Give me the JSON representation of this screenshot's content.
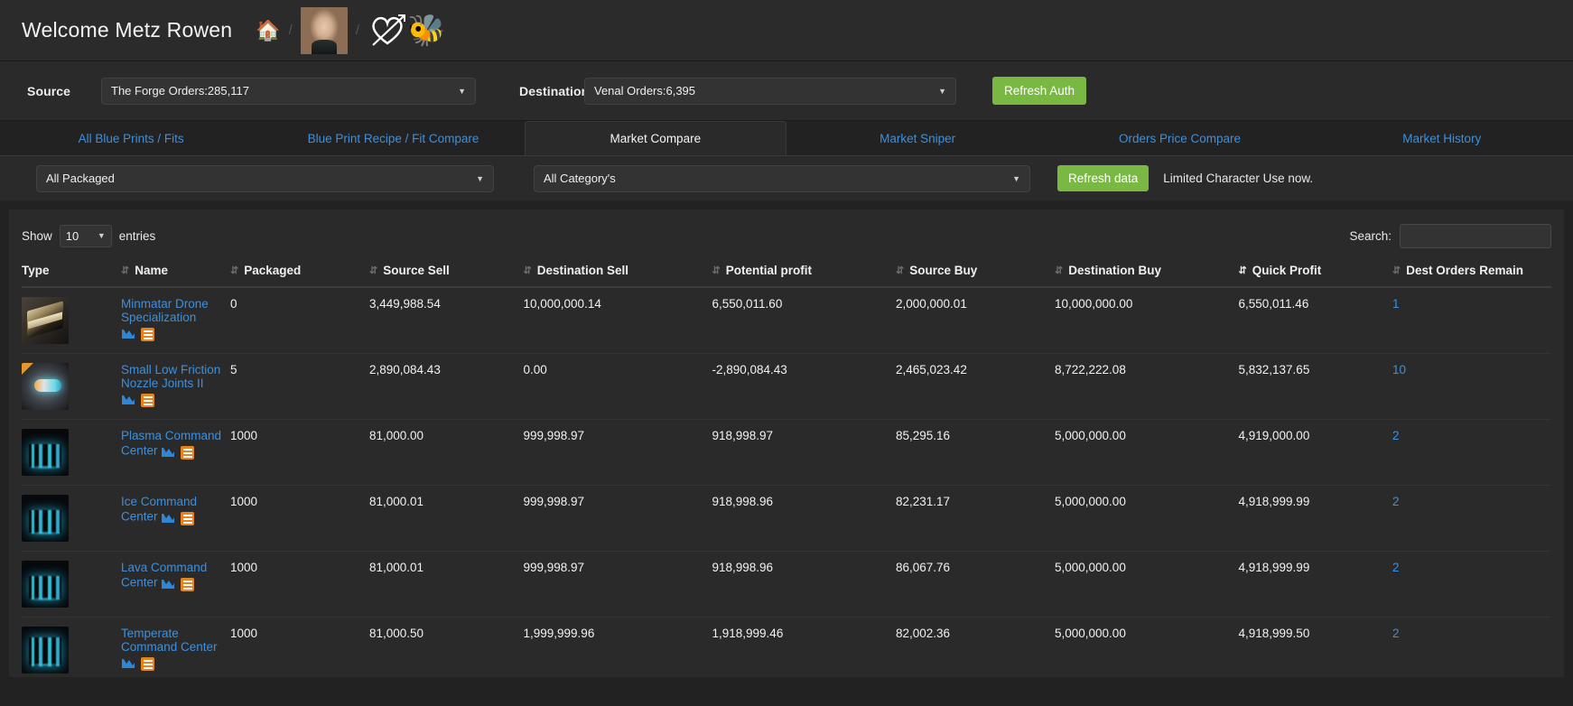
{
  "header": {
    "welcome": "Welcome Metz Rowen",
    "home_icon": "home-icon",
    "avatar_alt": "character-portrait",
    "heart_icon": "heart-arrow-icon",
    "bee_icon": "🐝",
    "separator": "/"
  },
  "selectors": {
    "source_label": "Source",
    "source_value": "The Forge Orders:285,117",
    "destination_label": "Destination",
    "destination_value": "Venal Orders:6,395",
    "refresh_auth_label": "Refresh Auth",
    "caret": "▼"
  },
  "tabs": [
    {
      "label": "All Blue Prints / Fits",
      "active": false
    },
    {
      "label": "Blue Print Recipe / Fit Compare",
      "active": false
    },
    {
      "label": "Market Compare",
      "active": true
    },
    {
      "label": "Market Sniper",
      "active": false
    },
    {
      "label": "Orders Price Compare",
      "active": false
    },
    {
      "label": "Market History",
      "active": false
    }
  ],
  "filters": {
    "packaged_value": "All Packaged",
    "category_value": "All Category's",
    "refresh_data_label": "Refresh data",
    "limited_note": "Limited Character Use now."
  },
  "table_controls": {
    "show_label": "Show",
    "entries_value": "10",
    "entries_label": "entries",
    "search_label": "Search:",
    "search_value": "",
    "search_placeholder": ""
  },
  "table": {
    "columns": [
      {
        "label": "Type",
        "sort": "none"
      },
      {
        "label": "Name",
        "sort": "none"
      },
      {
        "label": "Packaged",
        "sort": "none"
      },
      {
        "label": "Source Sell",
        "sort": "none"
      },
      {
        "label": "Destination Sell",
        "sort": "none"
      },
      {
        "label": "Potential profit",
        "sort": "none"
      },
      {
        "label": "Source Buy",
        "sort": "none"
      },
      {
        "label": "Destination Buy",
        "sort": "none"
      },
      {
        "label": "Quick Profit",
        "sort": "desc"
      },
      {
        "label": "Dest Orders Remain",
        "sort": "none"
      }
    ],
    "rows": [
      {
        "thumb": "book-icon",
        "name": "Minmatar Drone Specialization",
        "packaged": "0",
        "source_sell": "3,449,988.54",
        "destination_sell": "10,000,000.14",
        "potential_profit": "6,550,011.60",
        "source_buy": "2,000,000.01",
        "destination_buy": "10,000,000.00",
        "quick_profit": "6,550,011.46",
        "dest_orders_remain": "1"
      },
      {
        "thumb": "nozzle-icon",
        "name": "Small Low Friction Nozzle Joints II",
        "packaged": "5",
        "source_sell": "2,890,084.43",
        "destination_sell": "0.00",
        "potential_profit": "-2,890,084.43",
        "source_buy": "2,465,023.42",
        "destination_buy": "8,722,222.08",
        "quick_profit": "5,832,137.65",
        "dest_orders_remain": "10"
      },
      {
        "thumb": "command-center-icon",
        "name": "Plasma Command Center",
        "packaged": "1000",
        "source_sell": "81,000.00",
        "destination_sell": "999,998.97",
        "potential_profit": "918,998.97",
        "source_buy": "85,295.16",
        "destination_buy": "5,000,000.00",
        "quick_profit": "4,919,000.00",
        "dest_orders_remain": "2"
      },
      {
        "thumb": "command-center-icon",
        "name": "Ice Command Center",
        "packaged": "1000",
        "source_sell": "81,000.01",
        "destination_sell": "999,998.97",
        "potential_profit": "918,998.96",
        "source_buy": "82,231.17",
        "destination_buy": "5,000,000.00",
        "quick_profit": "4,918,999.99",
        "dest_orders_remain": "2"
      },
      {
        "thumb": "command-center-icon",
        "name": "Lava Command Center",
        "packaged": "1000",
        "source_sell": "81,000.01",
        "destination_sell": "999,998.97",
        "potential_profit": "918,998.96",
        "source_buy": "86,067.76",
        "destination_buy": "5,000,000.00",
        "quick_profit": "4,918,999.99",
        "dest_orders_remain": "2"
      },
      {
        "thumb": "command-center-icon",
        "name": "Temperate Command Center",
        "packaged": "1000",
        "source_sell": "81,000.50",
        "destination_sell": "1,999,999.96",
        "potential_profit": "1,918,999.46",
        "source_buy": "82,002.36",
        "destination_buy": "5,000,000.00",
        "quick_profit": "4,918,999.50",
        "dest_orders_remain": "2"
      }
    ]
  },
  "colors": {
    "accent_link": "#3b90e0",
    "button_green": "#78b843",
    "icon_orange": "#e8821e",
    "panel_bg": "#2a2a2a",
    "page_bg": "#222222"
  }
}
